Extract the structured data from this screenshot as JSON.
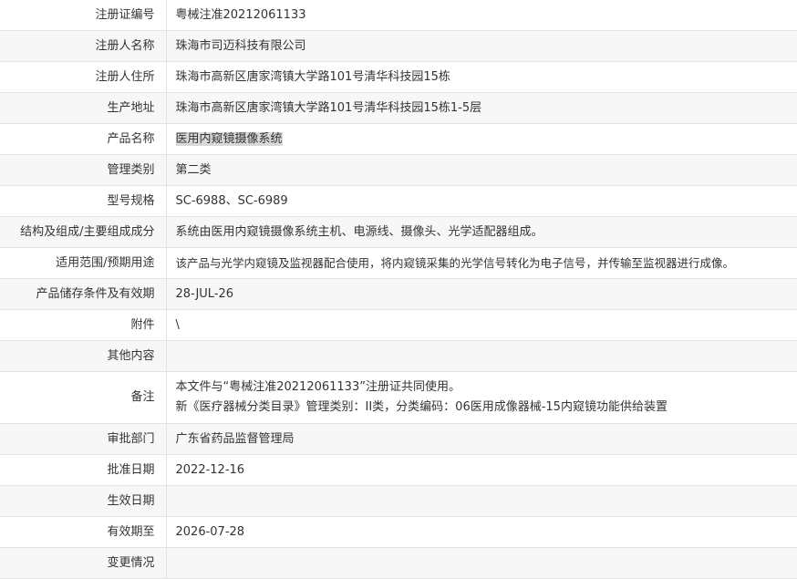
{
  "rows": [
    {
      "label": "注册证编号",
      "value": "粤械注准20212061133"
    },
    {
      "label": "注册人名称",
      "value": "珠海市司迈科技有限公司"
    },
    {
      "label": "注册人住所",
      "value": "珠海市高新区唐家湾镇大学路101号清华科技园15栋"
    },
    {
      "label": "生产地址",
      "value": "珠海市高新区唐家湾镇大学路101号清华科技园15栋1-5层"
    },
    {
      "label": "产品名称",
      "value": "医用内窥镜摄像系统"
    },
    {
      "label": "管理类别",
      "value": "第二类"
    },
    {
      "label": "型号规格",
      "value": "SC-6988、SC-6989"
    },
    {
      "label": "结构及组成/主要组成成分",
      "value": "系统由医用内窥镜摄像系统主机、电源线、摄像头、光学适配器组成。"
    },
    {
      "label": "适用范围/预期用途",
      "value": "该产品与光学内窥镜及监视器配合使用，将内窥镜采集的光学信号转化为电子信号，并传输至监视器进行成像。"
    },
    {
      "label": "产品储存条件及有效期",
      "value": "28-JUL-26"
    },
    {
      "label": "附件",
      "value": "\\"
    },
    {
      "label": "其他内容",
      "value": ""
    },
    {
      "label": "备注",
      "line1": "本文件与“粤械注准20212061133”注册证共同使用。",
      "line2": "新《医疗器械分类目录》管理类别：II类，分类编码：06医用成像器械-15内窥镜功能供给装置"
    },
    {
      "label": "审批部门",
      "value": "广东省药品监督管理局"
    },
    {
      "label": "批准日期",
      "value": "2022-12-16"
    },
    {
      "label": "生效日期",
      "value": ""
    },
    {
      "label": "有效期至",
      "value": "2026-07-28"
    },
    {
      "label": "变更情况",
      "value": ""
    }
  ]
}
